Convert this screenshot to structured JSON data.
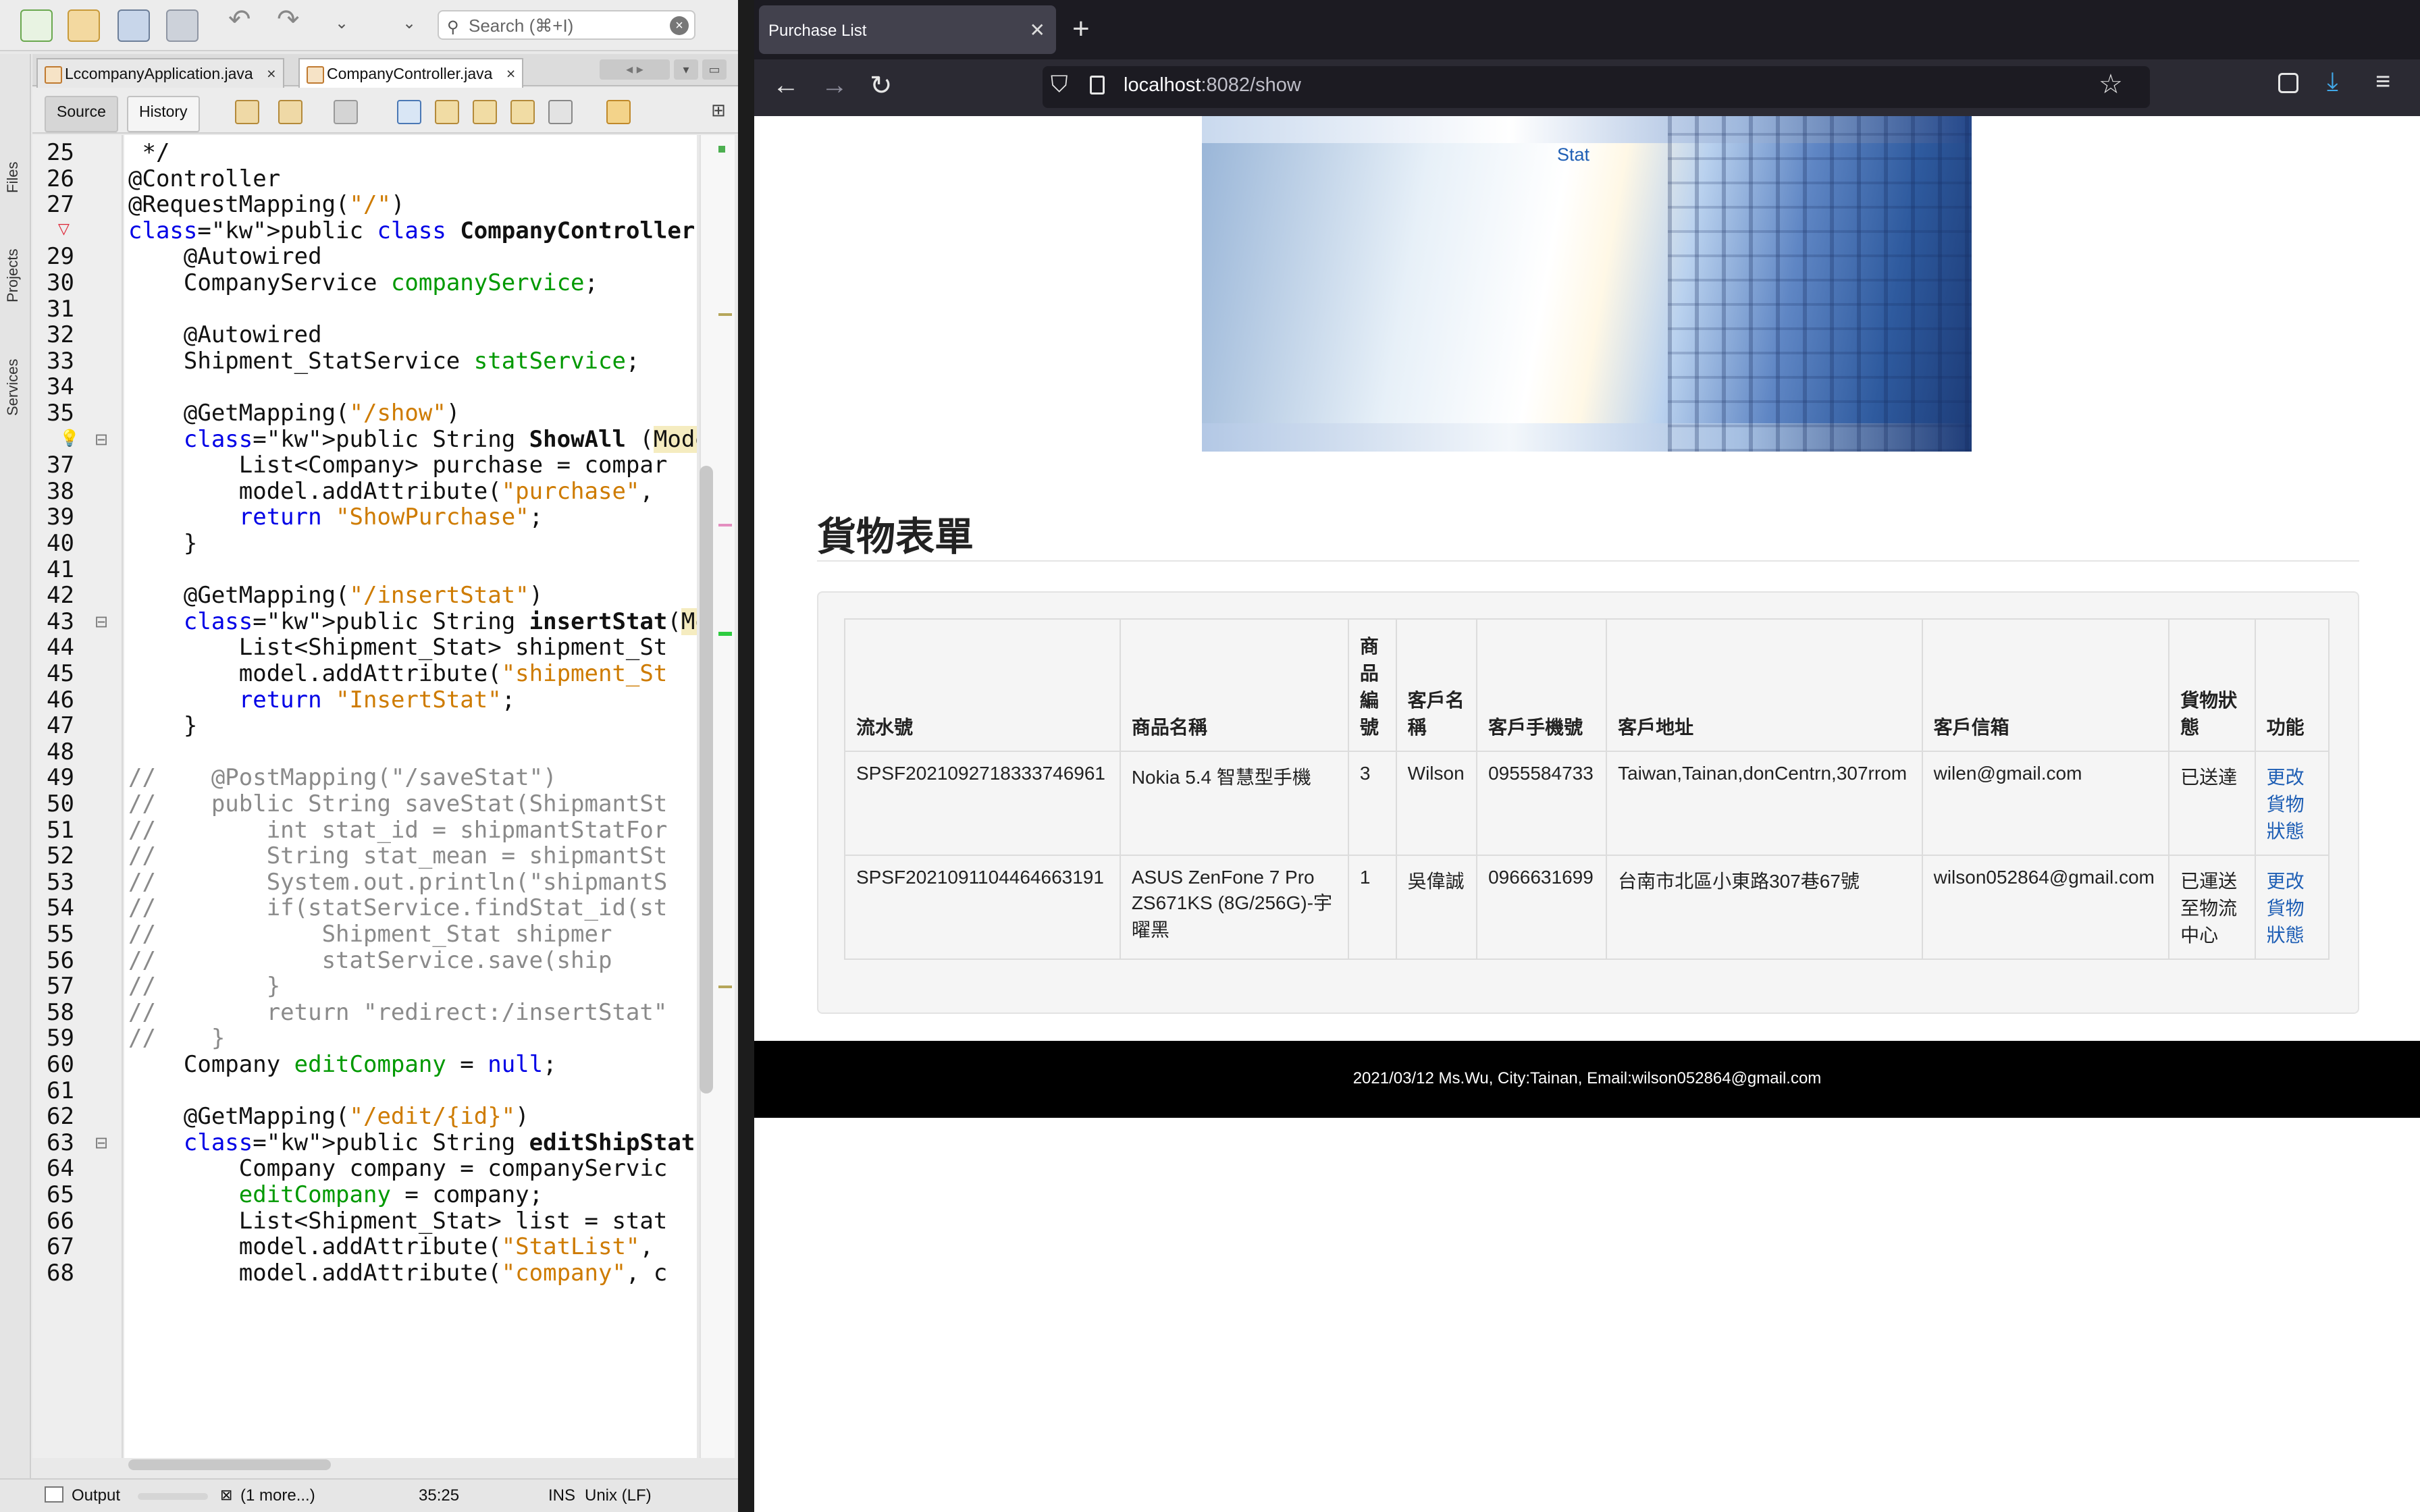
{
  "ide": {
    "search_placeholder": "Search (⌘+I)",
    "side_tabs": [
      "Files",
      "Projects",
      "Services"
    ],
    "file_tabs": [
      {
        "label": "LccompanyApplication.java",
        "active": false
      },
      {
        "label": "CompanyController.java",
        "active": true
      }
    ],
    "source_btn": "Source",
    "history_btn": "History",
    "line_numbers": [
      "25",
      "26",
      "27",
      "",
      "29",
      "30",
      "31",
      "32",
      "33",
      "34",
      "35",
      "",
      "37",
      "38",
      "39",
      "40",
      "41",
      "42",
      "43",
      "44",
      "45",
      "46",
      "47",
      "48",
      "49",
      "50",
      "51",
      "52",
      "53",
      "54",
      "55",
      "56",
      "57",
      "58",
      "59",
      "60",
      "61",
      "62",
      "63",
      "64",
      "65",
      "66",
      "67",
      "68"
    ],
    "code_lines": [
      " */",
      "@Controller",
      "@RequestMapping(\"/\")",
      "public class CompanyController {",
      "    @Autowired",
      "    CompanyService companyService;",
      "",
      "    @Autowired",
      "    Shipment_StatService statService;",
      "",
      "    @GetMapping(\"/show\")",
      "    public String ShowAll (Model model)",
      "        List<Company> purchase = compar",
      "        model.addAttribute(\"purchase\",",
      "        return \"ShowPurchase\";",
      "    }",
      "",
      "    @GetMapping(\"/insertStat\")",
      "    public String insertStat(Model mode",
      "        List<Shipment_Stat> shipment_St",
      "        model.addAttribute(\"shipment_St",
      "        return \"InsertStat\";",
      "    }",
      "",
      "//    @PostMapping(\"/saveStat\")",
      "//    public String saveStat(ShipmantSt",
      "//        int stat_id = shipmantStatFor",
      "//        String stat_mean = shipmantSt",
      "//        System.out.println(\"shipmantS",
      "//        if(statService.findStat_id(st",
      "//            Shipment_Stat shipmer",
      "//            statService.save(ship",
      "//        }",
      "//        return \"redirect:/insertStat\"",
      "//    }",
      "    Company editCompany = null;",
      "",
      "    @GetMapping(\"/edit/{id}\")",
      "    public String editShipStat(@PathVar",
      "        Company company = companyServic",
      "        editCompany = company;",
      "        List<Shipment_Stat> list = stat",
      "        model.addAttribute(\"StatList\",",
      "        model.addAttribute(\"company\", c"
    ],
    "status": {
      "output": "Output",
      "more": "(1 more...)",
      "position": "35:25",
      "mode": "INS",
      "eol": "Unix (LF)"
    }
  },
  "browser": {
    "tab_title": "Purchase List",
    "url_host": "localhost",
    "url_rest": ":8082/show",
    "banner_link": "Stat",
    "heading": "貨物表單",
    "table": {
      "headers": [
        "流水號",
        "商品名稱",
        "商品編號",
        "客戶名稱",
        "客戶手機號",
        "客戶地址",
        "客戶信箱",
        "貨物狀態",
        "功能"
      ],
      "rows": [
        [
          "SPSF2021092718333746961",
          "Nokia 5.4 智慧型手機",
          "3",
          "Wilson",
          "0955584733",
          "Taiwan,Tainan,donCentrn,307rrom",
          "wilen@gmail.com",
          "已送達",
          "更改貨物狀態"
        ],
        [
          "SPSF2021091104464663191",
          "ASUS ZenFone 7 Pro ZS671KS (8G/256G)-宇曜黑",
          "1",
          "吳偉誠",
          "0966631699",
          "台南市北區小東路307巷67號",
          "wilson052864@gmail.com",
          "已運送至物流中心",
          "更改貨物狀態"
        ]
      ]
    },
    "footer": "2021/03/12 Ms.Wu, City:Tainan, Email:wilson052864@gmail.com"
  },
  "colors": {
    "keyword": "#0000e6",
    "string": "#ce7b00",
    "field": "#009900",
    "comment": "#8a8a8a",
    "link": "#1f5fb5",
    "browser_chrome": "#2b2a33"
  }
}
